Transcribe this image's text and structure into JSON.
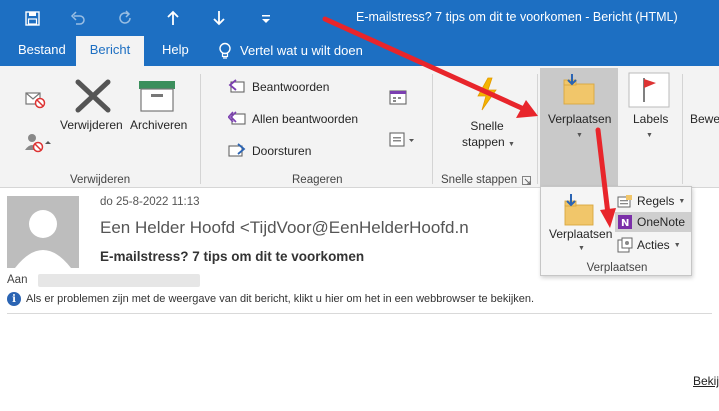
{
  "window": {
    "title": "E-mailstress? 7 tips om dit te voorkomen  -  Bericht (HTML)"
  },
  "quick_access": [
    {
      "name": "save-icon",
      "glyph": "💾"
    },
    {
      "name": "undo-icon",
      "glyph": "↶"
    },
    {
      "name": "redo-icon",
      "glyph": "↻"
    },
    {
      "name": "up-arrow-icon",
      "glyph": "↑"
    },
    {
      "name": "down-arrow-icon",
      "glyph": "↓"
    },
    {
      "name": "customize-icon",
      "glyph": "≡"
    }
  ],
  "tabs": [
    {
      "label": "Bestand",
      "active": false
    },
    {
      "label": "Bericht",
      "active": true
    },
    {
      "label": "Help",
      "active": false
    }
  ],
  "tell_me": "Vertel wat u wilt doen",
  "ribbon": {
    "delete_group": {
      "label": "Verwijderen",
      "delete_button": "Verwijderen",
      "archive_button": "Archiveren"
    },
    "respond_group": {
      "label": "Reageren",
      "reply": "Beantwoorden",
      "reply_all": "Allen beantwoorden",
      "forward": "Doorsturen"
    },
    "quick_steps_group": {
      "label": "Snelle stappen",
      "button_line1": "Snelle",
      "button_line2": "stappen"
    },
    "move_button": "Verplaatsen",
    "tags_button": "Labels",
    "partial_button": "Bewe"
  },
  "move_popup": {
    "move_button": "Verplaatsen",
    "rules": "Regels",
    "onenote": "OneNote",
    "actions": "Acties",
    "group_label": "Verplaatsen"
  },
  "message": {
    "date": "do 25-8-2022 11:13",
    "from": "Een Helder Hoofd <TijdVoor@EenHelderHoofd.n",
    "subject": "E-mailstress? 7 tips om dit te voorkomen",
    "to_label": "Aan",
    "info": "Als er problemen zijn met de weergave van dit bericht, klikt u hier om het in een webbrowser te bekijken.",
    "body_link": "Bekij"
  },
  "colors": {
    "brand_blue": "#1d6fc2",
    "annotation_red": "#e8252b",
    "onenote_purple": "#7b2fa8"
  }
}
